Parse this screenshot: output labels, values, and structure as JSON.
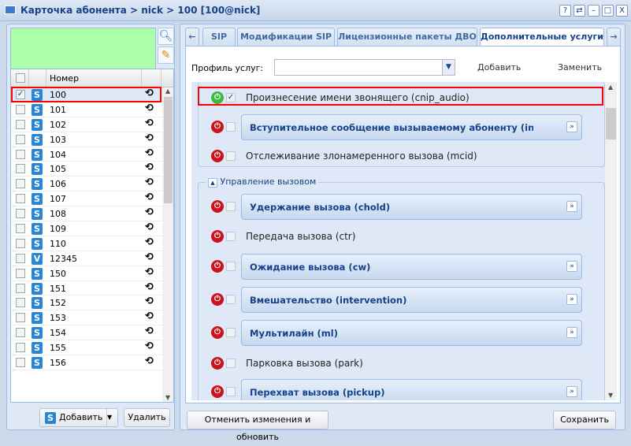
{
  "window": {
    "title": "Карточка абонента > nick > 100 [100@nick]",
    "buttons": [
      "?",
      "⇄",
      "–",
      "□",
      "X"
    ]
  },
  "left": {
    "grid_header": "Номер",
    "rows": [
      {
        "num": "100",
        "type": "S",
        "checked": true
      },
      {
        "num": "101",
        "type": "S"
      },
      {
        "num": "102",
        "type": "S"
      },
      {
        "num": "103",
        "type": "S"
      },
      {
        "num": "104",
        "type": "S"
      },
      {
        "num": "105",
        "type": "S"
      },
      {
        "num": "106",
        "type": "S"
      },
      {
        "num": "107",
        "type": "S"
      },
      {
        "num": "108",
        "type": "S"
      },
      {
        "num": "109",
        "type": "S"
      },
      {
        "num": "110",
        "type": "S"
      },
      {
        "num": "12345",
        "type": "V"
      },
      {
        "num": "150",
        "type": "S"
      },
      {
        "num": "151",
        "type": "S"
      },
      {
        "num": "152",
        "type": "S"
      },
      {
        "num": "153",
        "type": "S"
      },
      {
        "num": "154",
        "type": "S"
      },
      {
        "num": "155",
        "type": "S"
      },
      {
        "num": "156",
        "type": "S"
      }
    ],
    "add_label": "Добавить",
    "delete_label": "Удалить"
  },
  "tabs": [
    "SIP",
    "Модификации SIP",
    "Лицензионные пакеты ДВО",
    "Дополнительные услуги"
  ],
  "active_tab": 3,
  "profile": {
    "label": "Профиль услуг:",
    "value": "",
    "add": "Добавить",
    "replace": "Заменить"
  },
  "services_top": [
    {
      "label": "Произнесение имени звонящего (cnip_audio)",
      "on": true,
      "checked": true,
      "group": false
    },
    {
      "label": "Вступительное сообщение вызываемому абоненту (introduce)",
      "on": false,
      "group": true
    },
    {
      "label": "Отслеживание злонамеренного вызова (mcid)",
      "on": false,
      "group": false
    }
  ],
  "call_control": {
    "legend": "Управление вызовом",
    "items": [
      {
        "label": "Удержание вызова (chold)",
        "group": true
      },
      {
        "label": "Передача вызова (ctr)",
        "group": false
      },
      {
        "label": "Ожидание вызова (cw)",
        "group": true
      },
      {
        "label": "Вмешательство (intervention)",
        "group": true
      },
      {
        "label": "Мультилайн (ml)",
        "group": true
      },
      {
        "label": "Парковка вызова (park)",
        "group": false
      },
      {
        "label": "Перехват вызова (pickup)",
        "group": true
      }
    ]
  },
  "footer": {
    "cancel": "Отменить изменения и обновить",
    "save": "Сохранить"
  },
  "colors": {
    "highlight": "#ff0000",
    "green_box": "#aaffa8",
    "header": "#15428b"
  }
}
